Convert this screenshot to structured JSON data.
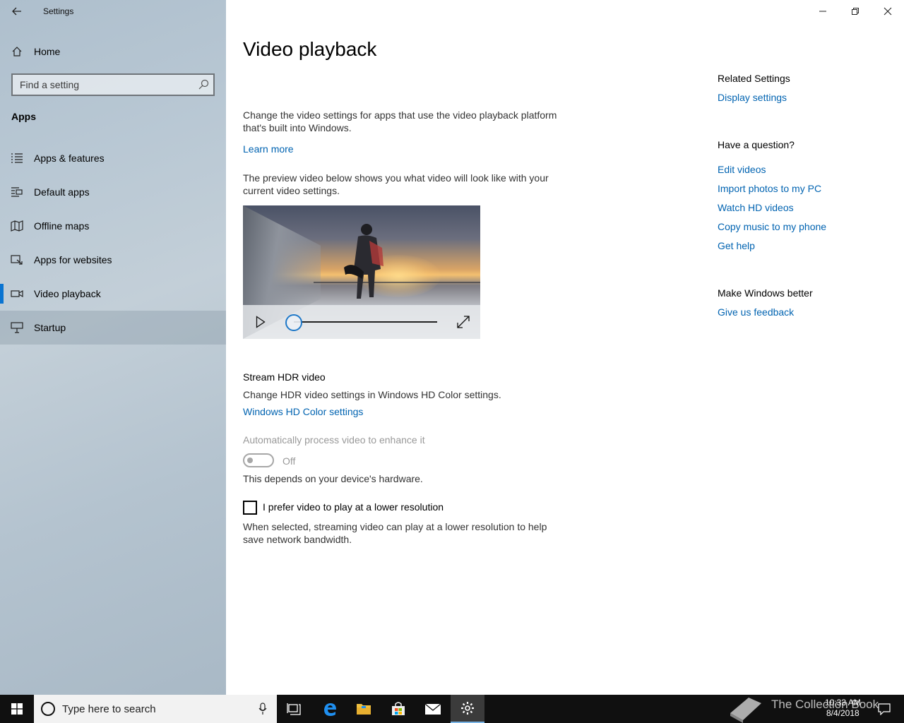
{
  "window": {
    "title": "Settings"
  },
  "sidebar": {
    "home_label": "Home",
    "search_placeholder": "Find a setting",
    "section": "Apps",
    "items": [
      {
        "label": "Apps & features",
        "icon": "list-icon"
      },
      {
        "label": "Default apps",
        "icon": "default-apps-icon"
      },
      {
        "label": "Offline maps",
        "icon": "map-icon"
      },
      {
        "label": "Apps for websites",
        "icon": "link-icon"
      },
      {
        "label": "Video playback",
        "icon": "video-icon"
      },
      {
        "label": "Startup",
        "icon": "startup-icon"
      }
    ],
    "selected_item": "Video playback"
  },
  "main": {
    "title": "Video playback",
    "intro": "Change the video settings for apps that use the video playback platform that's built into Windows.",
    "learn_more": "Learn more",
    "preview_desc": "The preview video below shows you what video will look like with your current video settings.",
    "video_progress": 0,
    "hdr_heading": "Stream HDR video",
    "hdr_desc": "Change HDR video settings in Windows HD Color settings.",
    "hdr_link": "Windows HD Color settings",
    "auto_process_label": "Automatically process video to enhance it",
    "auto_process_state": "Off",
    "hardware_note": "This depends on your device's hardware.",
    "lower_res_label": "I prefer video to play at a lower resolution",
    "lower_res_checked": false,
    "lower_res_desc": "When selected, streaming video can play at a lower resolution to help save network bandwidth."
  },
  "right": {
    "related_heading": "Related Settings",
    "related_links": [
      "Display settings"
    ],
    "question_heading": "Have a question?",
    "question_links": [
      "Edit videos",
      "Import photos to my PC",
      "Watch HD videos",
      "Copy music to my phone",
      "Get help"
    ],
    "better_heading": "Make Windows better",
    "feedback_link": "Give us feedback"
  },
  "taskbar": {
    "search_placeholder": "Type here to search",
    "watermark": "The Collection Book",
    "time": "10:33 AM",
    "date": "8/4/2018"
  },
  "colors": {
    "accent": "#0063b1",
    "selected_bar": "#0a74d1"
  }
}
